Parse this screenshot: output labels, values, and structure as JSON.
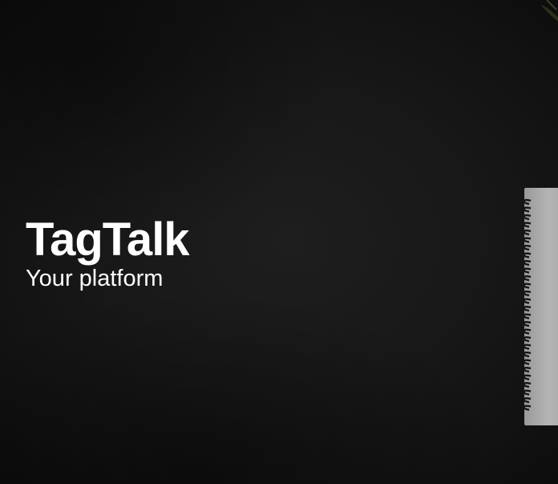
{
  "hero": {
    "title": "TagTalk",
    "tagline": "Your platform"
  },
  "colors": {
    "background": "#151515",
    "text": "#ffffff",
    "notebook_paper": "#a9a9a9",
    "spiral": "#1a1a1a"
  },
  "decorations": {
    "notebook": "spiral-notebook-photo",
    "plant": "plant-leaf-photo"
  }
}
